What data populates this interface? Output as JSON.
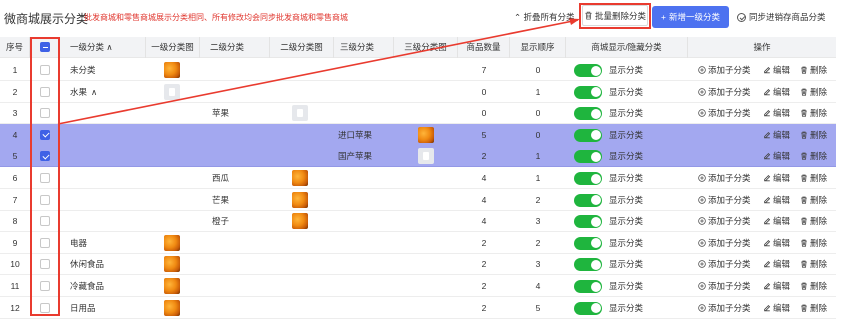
{
  "header": {
    "title": "微商城展示分类",
    "notice": "批发商城和零售商城展示分类相同、所有修改均会同步批发商城和零售商城",
    "collapse_label": "折叠所有分类",
    "batch_delete_label": "批量删除分类",
    "add_label": "新增一级分类",
    "sync_label": "同步进销存商品分类"
  },
  "columns": {
    "index": "序号",
    "level1": "一级分类",
    "level1_img": "一级分类图",
    "level2": "二级分类",
    "level2_img": "二级分类图",
    "level3": "三级分类",
    "level3_img": "三级分类图",
    "count": "商品数量",
    "order": "显示顺序",
    "visibility": "商城显示/隐藏分类",
    "actions": "操作"
  },
  "actions": {
    "add_sub": "添加子分类",
    "edit": "编辑",
    "delete": "删除"
  },
  "toggle_on_color": "#1fb53e",
  "selected_row_color": "#a3a8f0",
  "annotation_color": "#e93b2f",
  "rows": [
    {
      "index": "1",
      "checked": false,
      "level1": "未分类",
      "level1_img": "orange",
      "level2": "",
      "level2_img": "",
      "level3": "",
      "level3_img": "",
      "count": "7",
      "order": "0",
      "visible": true,
      "visible_label": "显示分类",
      "can_add_sub": true
    },
    {
      "index": "2",
      "checked": false,
      "level1": "水果",
      "level1_img": "blank",
      "level2": "",
      "level2_img": "",
      "level3": "",
      "level3_img": "",
      "count": "0",
      "order": "1",
      "visible": true,
      "visible_label": "显示分类",
      "can_add_sub": true
    },
    {
      "index": "3",
      "checked": false,
      "level1": "",
      "level1_img": "",
      "level2": "苹果",
      "level2_img": "blank",
      "level3": "",
      "level3_img": "",
      "count": "0",
      "order": "0",
      "visible": true,
      "visible_label": "显示分类",
      "can_add_sub": true
    },
    {
      "index": "4",
      "checked": true,
      "level1": "",
      "level1_img": "",
      "level2": "",
      "level2_img": "",
      "level3": "进口苹果",
      "level3_img": "orange",
      "count": "5",
      "order": "0",
      "visible": true,
      "visible_label": "显示分类",
      "can_add_sub": false
    },
    {
      "index": "5",
      "checked": true,
      "level1": "",
      "level1_img": "",
      "level2": "",
      "level2_img": "",
      "level3": "国产苹果",
      "level3_img": "blank",
      "count": "2",
      "order": "1",
      "visible": true,
      "visible_label": "显示分类",
      "can_add_sub": false
    },
    {
      "index": "6",
      "checked": false,
      "level1": "",
      "level1_img": "",
      "level2": "西瓜",
      "level2_img": "orange",
      "level3": "",
      "level3_img": "",
      "count": "4",
      "order": "1",
      "visible": true,
      "visible_label": "显示分类",
      "can_add_sub": true
    },
    {
      "index": "7",
      "checked": false,
      "level1": "",
      "level1_img": "",
      "level2": "芒果",
      "level2_img": "orange",
      "level3": "",
      "level3_img": "",
      "count": "4",
      "order": "2",
      "visible": true,
      "visible_label": "显示分类",
      "can_add_sub": true
    },
    {
      "index": "8",
      "checked": false,
      "level1": "",
      "level1_img": "",
      "level2": "橙子",
      "level2_img": "orange",
      "level3": "",
      "level3_img": "",
      "count": "4",
      "order": "3",
      "visible": true,
      "visible_label": "显示分类",
      "can_add_sub": true
    },
    {
      "index": "9",
      "checked": false,
      "level1": "电器",
      "level1_img": "orange",
      "level2": "",
      "level2_img": "",
      "level3": "",
      "level3_img": "",
      "count": "2",
      "order": "2",
      "visible": true,
      "visible_label": "显示分类",
      "can_add_sub": true
    },
    {
      "index": "10",
      "checked": false,
      "level1": "休闲食品",
      "level1_img": "orange",
      "level2": "",
      "level2_img": "",
      "level3": "",
      "level3_img": "",
      "count": "2",
      "order": "3",
      "visible": true,
      "visible_label": "显示分类",
      "can_add_sub": true
    },
    {
      "index": "11",
      "checked": false,
      "level1": "冷藏食品",
      "level1_img": "orange",
      "level2": "",
      "level2_img": "",
      "level3": "",
      "level3_img": "",
      "count": "2",
      "order": "4",
      "visible": true,
      "visible_label": "显示分类",
      "can_add_sub": true
    },
    {
      "index": "12",
      "checked": false,
      "level1": "日用品",
      "level1_img": "orange",
      "level2": "",
      "level2_img": "",
      "level3": "",
      "level3_img": "",
      "count": "2",
      "order": "5",
      "visible": true,
      "visible_label": "显示分类",
      "can_add_sub": true
    }
  ]
}
